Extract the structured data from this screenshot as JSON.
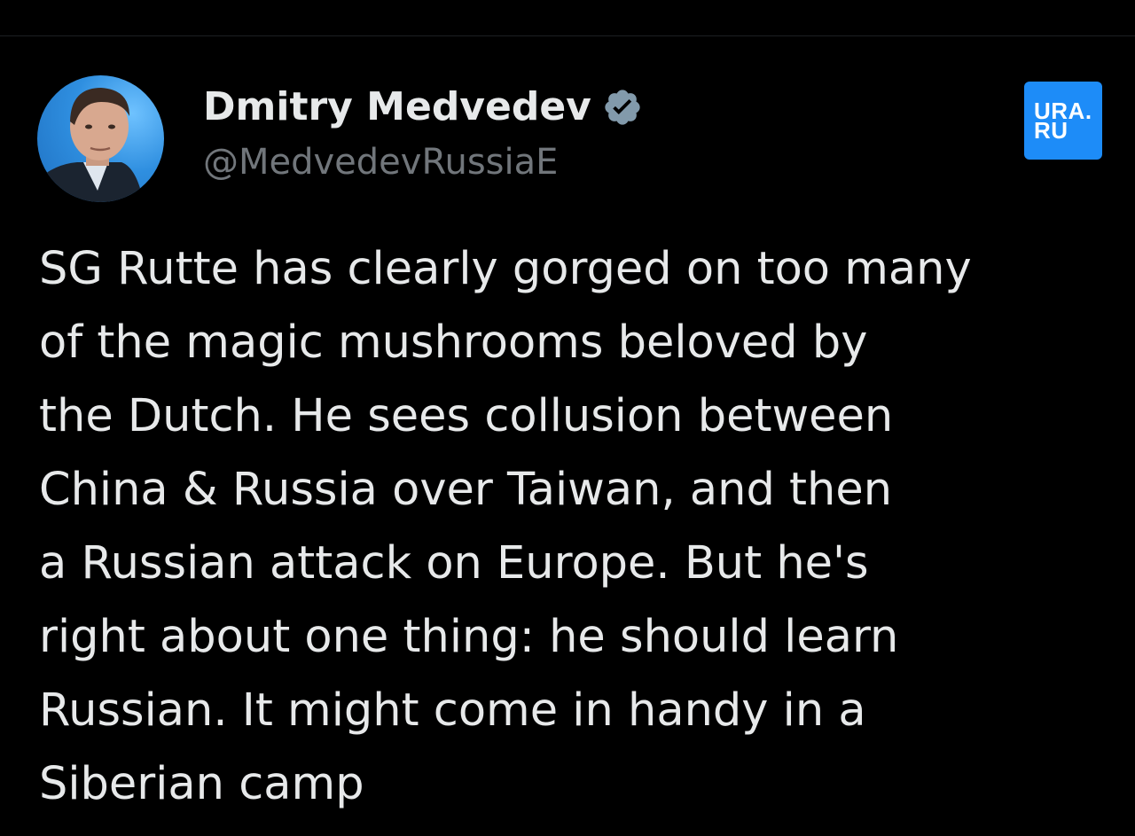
{
  "author": {
    "display_name": "Dmitry Medvedev",
    "handle": "@MedvedevRussiaE",
    "verified": true,
    "verified_icon": "verified-badge-icon",
    "avatar": "profile-photo"
  },
  "watermark": {
    "text": "URA. RU",
    "color": "#1d8cf8"
  },
  "tweet": {
    "lines": [
      "SG Rutte has clearly gorged on too many",
      "of the magic mushrooms beloved by",
      "the Dutch. He sees collusion between",
      "China & Russia over Taiwan, and then",
      "a Russian attack on Europe. But he's",
      "right about one thing: he should learn",
      "Russian. It might come in handy in a",
      "Siberian camp"
    ]
  },
  "colors": {
    "background": "#000000",
    "text_primary": "#e7e9ea",
    "text_secondary": "#71767b",
    "verified_badge": "#829aab"
  }
}
